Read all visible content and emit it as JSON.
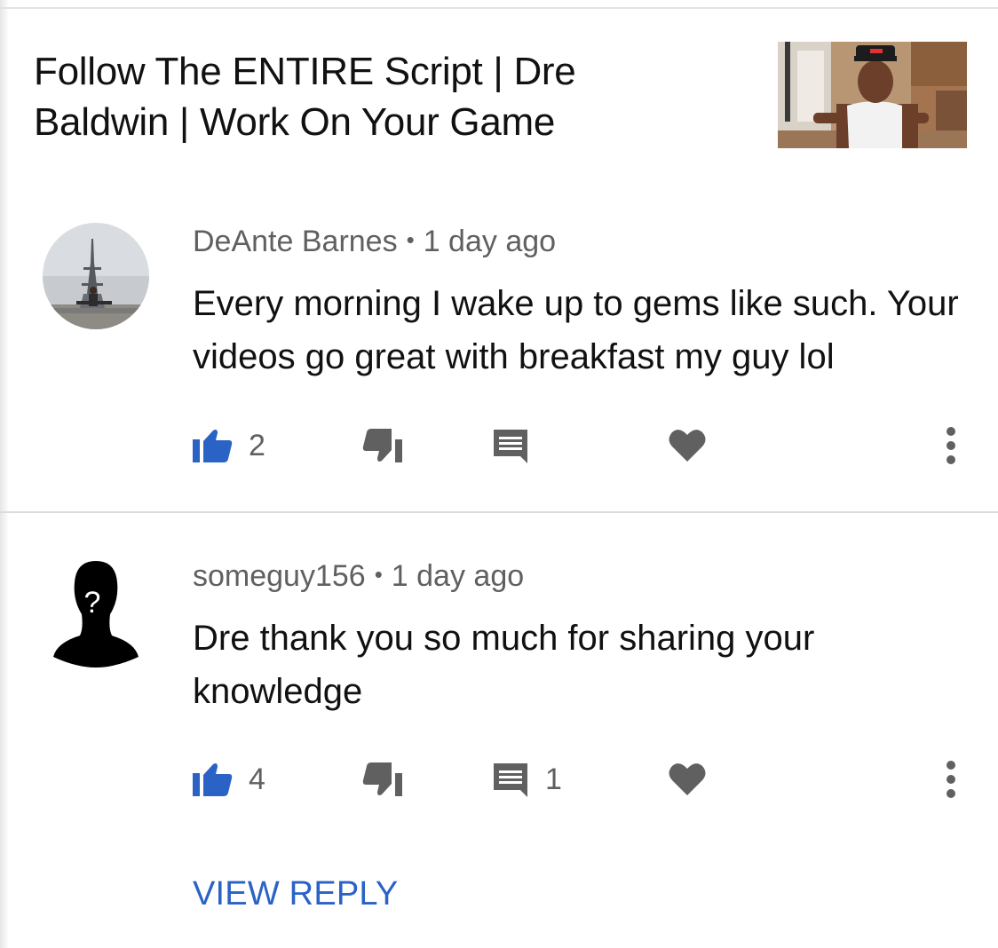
{
  "video": {
    "title": "Follow The ENTIRE Script | Dre Baldwin | Work On Your Game"
  },
  "comments": [
    {
      "author": "DeAnte Barnes",
      "separator": "•",
      "time": "1 day ago",
      "text": "Every morning I wake up to gems like such. Your videos go great with breakfast my guy lol",
      "likes": "2",
      "replies": ""
    },
    {
      "author": "someguy156",
      "separator": "•",
      "time": "1 day ago",
      "text": "Dre thank you so much for sharing your knowledge",
      "likes": "4",
      "replies": "1",
      "view_reply_label": "VIEW REPLY"
    }
  ],
  "colors": {
    "accent_blue": "#2a62c6",
    "icon_gray": "#606060",
    "text": "#111111",
    "divider": "#dcdcdc"
  },
  "icons": {
    "like": "thumbs-up-icon",
    "dislike": "thumbs-down-icon",
    "reply": "comment-icon",
    "heart": "heart-icon",
    "menu": "more-vertical-icon"
  }
}
